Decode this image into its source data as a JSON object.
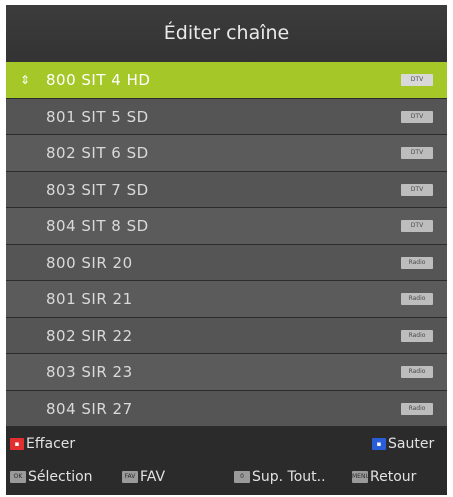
{
  "header": {
    "title": "Éditer chaîne"
  },
  "channels": [
    {
      "name": "800 SIT 4 HD",
      "badge": "DTV",
      "selected": true
    },
    {
      "name": "801 SIT 5 SD",
      "badge": "DTV"
    },
    {
      "name": "802 SIT 6 SD",
      "badge": "DTV"
    },
    {
      "name": "803 SIT 7 SD",
      "badge": "DTV"
    },
    {
      "name": "804 SIT 8 SD",
      "badge": "DTV"
    },
    {
      "name": "800 SIR 20",
      "badge": "Radio"
    },
    {
      "name": "801 SIR 21",
      "badge": "Radio"
    },
    {
      "name": "802 SIR 22",
      "badge": "Radio"
    },
    {
      "name": "803 SIR 23",
      "badge": "Radio"
    },
    {
      "name": "804 SIR 27",
      "badge": "Radio"
    }
  ],
  "footer": {
    "delete": {
      "key": "red-key-icon",
      "label": "Effacer"
    },
    "skip": {
      "key": "blue-key-icon",
      "label": "Sauter"
    },
    "select": {
      "key_text": "OK",
      "label": "Sélection"
    },
    "fav": {
      "key_text": "FAV",
      "label": "FAV"
    },
    "delete_all": {
      "key_text": "0",
      "label": "Sup. Tout.."
    },
    "back": {
      "key_text": "MENU",
      "label": "Retour"
    }
  },
  "colors": {
    "selected_row": "#a6c728",
    "background": "#2f2f2f",
    "red_key": "#e23030",
    "blue_key": "#2a5ed8"
  }
}
